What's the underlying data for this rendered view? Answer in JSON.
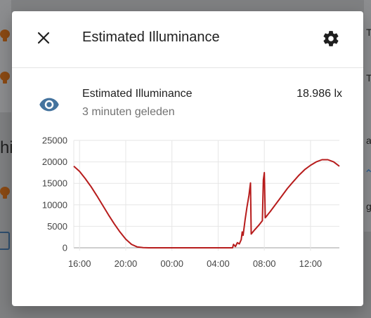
{
  "dialog": {
    "title": "Estimated Illuminance",
    "close_icon": "close-icon",
    "settings_icon": "gear-icon"
  },
  "entity": {
    "icon": "eye-icon",
    "name": "Estimated Illuminance",
    "last_changed": "3 minuten geleden",
    "state": "18.986 lx",
    "icon_color": "#44739e"
  },
  "background": {
    "left_fragment": "hi",
    "right_fragments": [
      "T",
      "T",
      "a",
      "g"
    ]
  },
  "chart_data": {
    "type": "line",
    "title": "",
    "xlabel": "",
    "ylabel": "",
    "ylim": [
      0,
      25000
    ],
    "yticks": [
      0,
      5000,
      10000,
      15000,
      20000,
      25000
    ],
    "xlim": [
      "15:30",
      "14:30"
    ],
    "xticks": [
      "16:00",
      "20:00",
      "00:00",
      "04:00",
      "08:00",
      "12:00"
    ],
    "grid": true,
    "series": [
      {
        "color": "#b71c1c",
        "points": [
          [
            "15:30",
            18986
          ],
          [
            "16:00",
            17800
          ],
          [
            "16:30",
            16100
          ],
          [
            "17:00",
            14200
          ],
          [
            "17:30",
            12100
          ],
          [
            "18:00",
            9900
          ],
          [
            "18:30",
            7700
          ],
          [
            "19:00",
            5600
          ],
          [
            "19:30",
            3700
          ],
          [
            "20:00",
            2000
          ],
          [
            "20:30",
            800
          ],
          [
            "21:00",
            200
          ],
          [
            "21:30",
            30
          ],
          [
            "22:00",
            0
          ],
          [
            "05:15",
            0
          ],
          [
            "05:20",
            800
          ],
          [
            "05:30",
            300
          ],
          [
            "05:40",
            1200
          ],
          [
            "05:50",
            900
          ],
          [
            "06:00",
            1900
          ],
          [
            "06:05",
            3700
          ],
          [
            "06:10",
            2900
          ],
          [
            "06:20",
            6500
          ],
          [
            "06:30",
            9500
          ],
          [
            "06:40",
            12200
          ],
          [
            "06:48",
            15100
          ],
          [
            "06:52",
            3200
          ],
          [
            "07:10",
            4200
          ],
          [
            "07:30",
            5200
          ],
          [
            "07:50",
            6300
          ],
          [
            "07:55",
            15800
          ],
          [
            "08:00",
            17500
          ],
          [
            "08:05",
            7000
          ],
          [
            "08:30",
            8400
          ],
          [
            "09:00",
            10200
          ],
          [
            "09:30",
            12000
          ],
          [
            "10:00",
            13800
          ],
          [
            "10:30",
            15400
          ],
          [
            "11:00",
            16900
          ],
          [
            "11:30",
            18200
          ],
          [
            "12:00",
            19200
          ],
          [
            "12:30",
            20000
          ],
          [
            "13:00",
            20500
          ],
          [
            "13:30",
            20500
          ],
          [
            "14:00",
            20000
          ],
          [
            "14:30",
            18986
          ]
        ]
      }
    ]
  }
}
